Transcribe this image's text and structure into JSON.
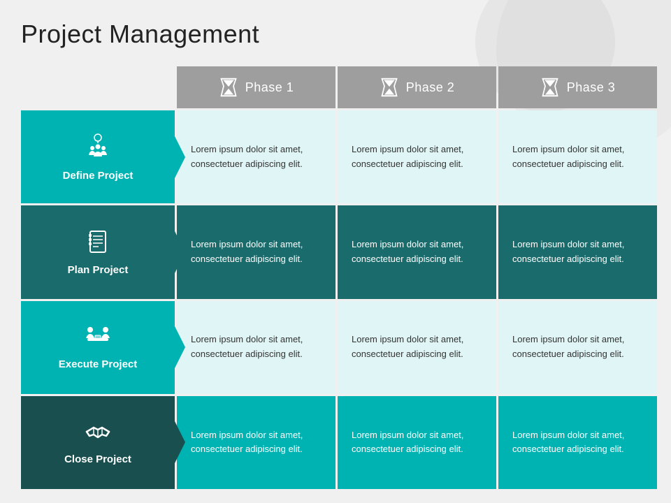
{
  "title": "Project Management",
  "phases": [
    {
      "label": "Phase 1"
    },
    {
      "label": "Phase 2"
    },
    {
      "label": "Phase 3"
    }
  ],
  "rows": [
    {
      "id": "define",
      "label": "Define Project",
      "icon": "👥",
      "iconAlt": "people-lightbulb-icon",
      "colorClass": "row-label-1"
    },
    {
      "id": "plan",
      "label": "Plan Project",
      "icon": "📋",
      "iconAlt": "checklist-icon",
      "colorClass": "row-label-2"
    },
    {
      "id": "execute",
      "label": "Execute Project",
      "icon": "🤝",
      "iconAlt": "meeting-icon",
      "colorClass": "row-label-3"
    },
    {
      "id": "close",
      "label": "Close Project",
      "icon": "🤝",
      "iconAlt": "handshake-icon",
      "colorClass": "row-label-4"
    }
  ],
  "placeholder_text": "Lorem ipsum dolor sit amet, consectetuer adipiscing elit.",
  "cells": [
    [
      "Lorem ipsum dolor sit amet, consectetuer adipiscing elit.",
      "Lorem ipsum dolor sit amet, consectetuer adipiscing elit.",
      "Lorem ipsum dolor sit amet, consectetuer adipiscing elit."
    ],
    [
      "Lorem ipsum dolor sit amet, consectetuer adipiscing elit.",
      "Lorem ipsum dolor sit amet, consectetuer adipiscing elit.",
      "Lorem ipsum dolor sit amet, consectetuer adipiscing elit."
    ],
    [
      "Lorem ipsum dolor sit amet, consectetuer adipiscing elit.",
      "Lorem ipsum dolor sit amet, consectetuer adipiscing elit.",
      "Lorem ipsum dolor sit amet, consectetuer adipiscing elit."
    ],
    [
      "Lorem ipsum dolor sit amet, consectetuer adipiscing elit.",
      "Lorem ipsum dolor sit amet, consectetuer adipiscing elit.",
      "Lorem ipsum dolor sit amet, consectetuer adipiscing elit."
    ]
  ]
}
